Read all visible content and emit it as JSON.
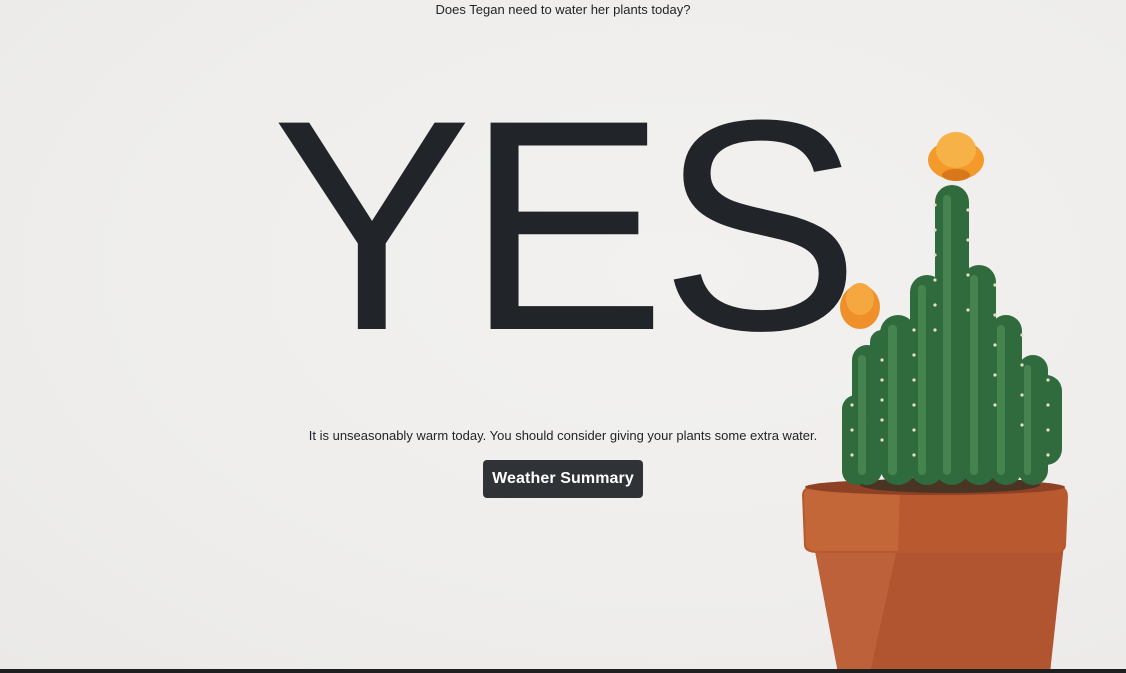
{
  "page": {
    "question": "Does Tegan need to water her plants today?",
    "answer": "YES",
    "message": "It is unseasonably warm today. You should consider giving your plants some extra water.",
    "weather_button_label": "Weather Summary"
  },
  "colors": {
    "background": "#efeeec",
    "text": "#212428",
    "button_bg": "#2f3337",
    "button_text": "#ffffff",
    "pot": "#b5582f",
    "cactus": "#2f6b3c",
    "flower": "#f39a2a"
  },
  "image": {
    "name": "cactus-in-pot"
  }
}
